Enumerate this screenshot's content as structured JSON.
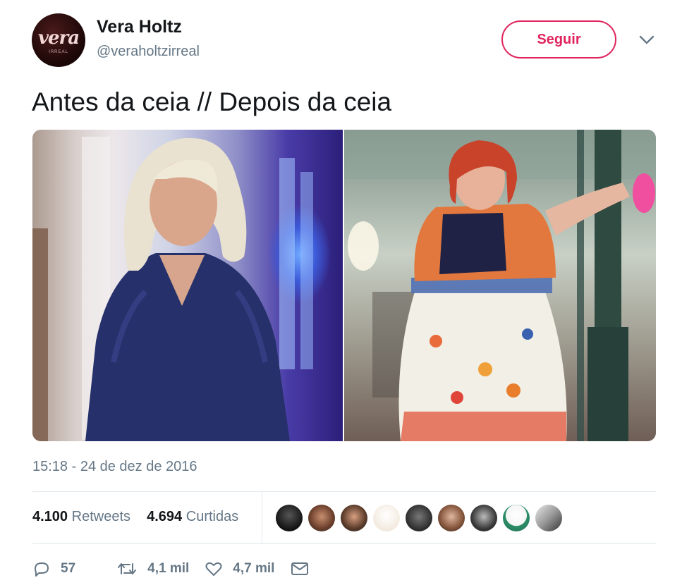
{
  "user": {
    "name": "Vera Holtz",
    "handle": "@veraholtzirreal",
    "avatar_text": "vera",
    "avatar_sub": "IRREAL"
  },
  "follow_button": {
    "label": "Seguir",
    "color": "#e0245e"
  },
  "menu": {
    "icon": "chevron-down-icon"
  },
  "tweet": {
    "text": "Antes da ceia // Depois da ceia",
    "timestamp": "15:18 - 24 de dez de 2016"
  },
  "stats": {
    "retweets_count": "4.100",
    "retweets_label": "Retweets",
    "likes_count": "4.694",
    "likes_label": "Curtidas"
  },
  "actions": {
    "reply_count": "57",
    "retweet_count": "4,1 mil",
    "like_count": "4,7 mil"
  },
  "colors": {
    "text": "#14171a",
    "secondary": "#657786",
    "divider": "#e1e8ed"
  }
}
